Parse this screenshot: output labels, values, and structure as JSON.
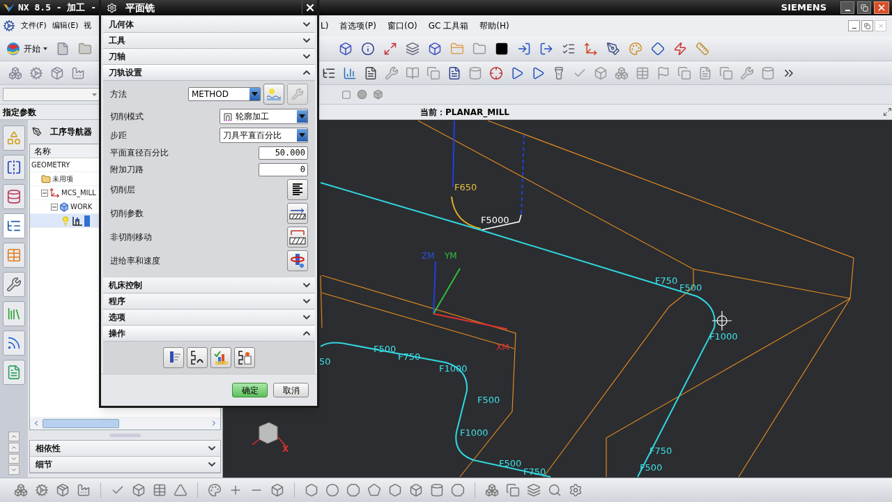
{
  "app_title": "NX 8.5 - 加工 -",
  "brand": "SIEMENS",
  "menu_left": [
    "文件(F)",
    "编辑(E)",
    "视"
  ],
  "menu_right": [
    "L)",
    "首选项(P)",
    "窗口(O)",
    "GC 工具箱",
    "帮助(H)"
  ],
  "start_button": "开始",
  "panel_title": "指定参数",
  "side_tabs": [
    {
      "selected": false
    },
    {
      "selected": false
    },
    {
      "selected": false
    },
    {
      "selected": true
    },
    {
      "selected": false
    },
    {
      "selected": false
    },
    {
      "selected": false
    },
    {
      "selected": false
    },
    {
      "selected": false
    }
  ],
  "current_label": "当前：PLANAR_MILL",
  "navigator": {
    "title": "工序导航器",
    "column": "名称",
    "tree": [
      {
        "label": "GEOMETRY",
        "selected": false,
        "children": [
          {
            "label": "未用项",
            "kind": "folder",
            "selected": false
          },
          {
            "label": "MCS_MILL",
            "kind": "mcs",
            "expanded": true,
            "selected": false,
            "children": [
              {
                "label": "WORK",
                "kind": "workpiece",
                "expanded": true,
                "selected": false,
                "children": [
                  {
                    "kind": "operation",
                    "selected": true
                  }
                ]
              }
            ]
          }
        ]
      }
    ],
    "sections": [
      {
        "label": "相依性",
        "expanded": false
      },
      {
        "label": "细节",
        "expanded": false
      }
    ]
  },
  "dialog": {
    "title": "平面铣",
    "groups_top": [
      {
        "label": "几何体",
        "expanded": false
      },
      {
        "label": "工具",
        "expanded": false
      },
      {
        "label": "刀轴",
        "expanded": false
      },
      {
        "label": "刀轨设置",
        "expanded": true
      }
    ],
    "settings": [
      {
        "kind": "method",
        "label": "方法",
        "value": "METHOD"
      },
      {
        "kind": "icon_dropdown",
        "label": "切削模式",
        "value": "轮廓加工"
      },
      {
        "kind": "dropdown",
        "label": "步距",
        "value": "刀具平直百分比"
      },
      {
        "kind": "number",
        "label": "平面直径百分比",
        "value": "50.000"
      },
      {
        "kind": "number",
        "label": "附加刀路",
        "value": "0"
      },
      {
        "kind": "button",
        "label": "切削层"
      },
      {
        "kind": "button",
        "label": "切削参数"
      },
      {
        "kind": "button",
        "label": "非切削移动"
      },
      {
        "kind": "button",
        "label": "进给率和速度"
      }
    ],
    "groups_bottom": [
      {
        "label": "机床控制",
        "expanded": false
      },
      {
        "label": "程序",
        "expanded": false
      },
      {
        "label": "选项",
        "expanded": false
      },
      {
        "label": "操作",
        "expanded": true
      }
    ],
    "ok": "确定",
    "cancel": "取消"
  },
  "path_labels": [
    {
      "text": "F650",
      "color": "#e8c040"
    },
    {
      "text": "F5000",
      "color": "#ffffff"
    },
    {
      "text": "F750",
      "color": "#40e0e8"
    },
    {
      "text": "F500",
      "color": "#40e0e8"
    },
    {
      "text": "F1000",
      "color": "#40e0e8"
    },
    {
      "text": "50",
      "color": "#40e0e8"
    },
    {
      "text": "F500",
      "color": "#40e0e8"
    },
    {
      "text": "F750",
      "color": "#40e0e8"
    },
    {
      "text": "F1000",
      "color": "#40e0e8"
    },
    {
      "text": "F500",
      "color": "#40e0e8"
    },
    {
      "text": "F1000",
      "color": "#40e0e8"
    },
    {
      "text": "F500",
      "color": "#40e0e8"
    },
    {
      "text": "F750",
      "color": "#40e0e8"
    },
    {
      "text": "F750",
      "color": "#40e0e8"
    },
    {
      "text": "F500",
      "color": "#40e0e8"
    }
  ],
  "axes": [
    {
      "text": "ZM",
      "color": "#2a50e0"
    },
    {
      "text": "YM",
      "color": "#30c040"
    },
    {
      "text": "XM",
      "color": "#e03030"
    },
    {
      "text": "X",
      "color": "#e03030"
    }
  ]
}
